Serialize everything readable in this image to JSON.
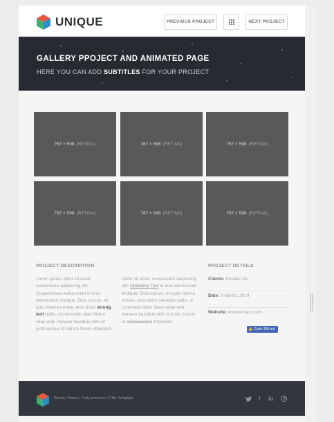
{
  "header": {
    "logo_text": "UNIQUE",
    "prev_label": "PREVIOUS PROJECT",
    "next_label": "NEXT PROJECT"
  },
  "hero": {
    "title": "GALLERY PPOJECT AND ANIMATED PAGE",
    "sub_before": "HERE YOU CAN ADD",
    "sub_bold": "SUBTITLES",
    "sub_after": "FOR YOUR PROJECT"
  },
  "gallery": {
    "items": [
      {
        "size": "767 × 598",
        "tag": "(RETINA)"
      },
      {
        "size": "767 × 598",
        "tag": "(RETINA)"
      },
      {
        "size": "767 × 598",
        "tag": "(RETINA)"
      },
      {
        "size": "767 × 598",
        "tag": "(RETINA)"
      },
      {
        "size": "767 × 598",
        "tag": "(RETINA)"
      },
      {
        "size": "767 × 598",
        "tag": "(RETINA)"
      }
    ]
  },
  "description": {
    "title": "PROJECT DESCRIPITON",
    "col1_a": "Lorem ipsum dolor sit amet, consectetur adipiscing elit. Suspendisse varius enim in eros elementum tristique. Duis cursus, mi quis viverra ornare, eros dolor",
    "col1_bold": "strong text",
    "col1_b": "nulla, ut commodo diam libero vitae erat. Aenean faucibus nibh et justo cursus id rutrum lorem imperdiet.",
    "col2_a": "Dolor sit amet, consectetur adipiscing elit.",
    "col2_link": "Underline Text",
    "col2_b": "in eros elementum tristique. Duis cursus, mi quis viverra ornare, eros dolor interdum nulla, ut commodo diam libero vitae erat. Aenean faucibus nibh et justo cursus id",
    "col2_strike": "strikeout text",
    "col2_c": "imperdiet."
  },
  "details": {
    "title": "PROJECT DETAILS",
    "clients_label": "Clients:",
    "clients_value": "Envato Ltd.",
    "date_label": "Date:",
    "date_value": "9 March, 2014",
    "website_label": "Website:",
    "website_value": "www.envato.com",
    "like_label": "Curtir 256 mil"
  },
  "footer": {
    "text": "Woozy Theme | Truly premium HTML Template",
    "social": [
      "twitter-icon",
      "facebook-icon",
      "linkedin-icon",
      "pinterest-icon"
    ],
    "social_glyphs": [
      "🐦",
      "f",
      "in",
      "℗"
    ]
  },
  "colors": {
    "hero_bg": "#252b30",
    "footer_bg": "#31373c",
    "tile_bg": "#595959",
    "page_bg": "#f5f5f5"
  }
}
